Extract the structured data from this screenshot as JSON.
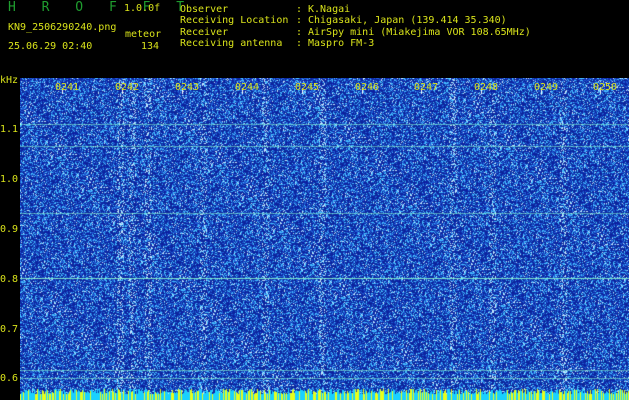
{
  "header": {
    "brand": "H R O F F T",
    "version": "1.0.0f",
    "filename": "KN9_2506290240.png",
    "mode": "meteor",
    "datetime": "25.06.29 02:40",
    "count": "134"
  },
  "metadata": [
    {
      "label": "Observer",
      "sep": ":",
      "value": "K.Nagai"
    },
    {
      "label": "Receiving Location",
      "sep": ":",
      "value": "Chigasaki, Japan (139.414 35.340)"
    },
    {
      "label": "Receiver",
      "sep": ":",
      "value": "AirSpy mini (Miakejima VOR 108.65MHz)"
    },
    {
      "label": "Receiving antenna",
      "sep": ":",
      "value": "Maspro FM-3"
    }
  ],
  "plot": {
    "y_unit": "kHz",
    "y_ticks": [
      "1.1",
      "1.0",
      "0.9",
      "0.8",
      "0.7",
      "0.6"
    ],
    "time_labels": [
      "0241",
      "0242",
      "0243",
      "0244",
      "0245",
      "0246",
      "0247",
      "0248",
      "0249",
      "0250"
    ],
    "colors": {
      "background": "#0a1a9e",
      "noise_cyan": "#49c7ff",
      "noise_white": "#cfe9ff",
      "carrier": "#8cffd0",
      "bottom_band": "#19d1ff",
      "bottom_band_alt": "#e8ff1a",
      "text": "#d9e31a"
    }
  }
}
